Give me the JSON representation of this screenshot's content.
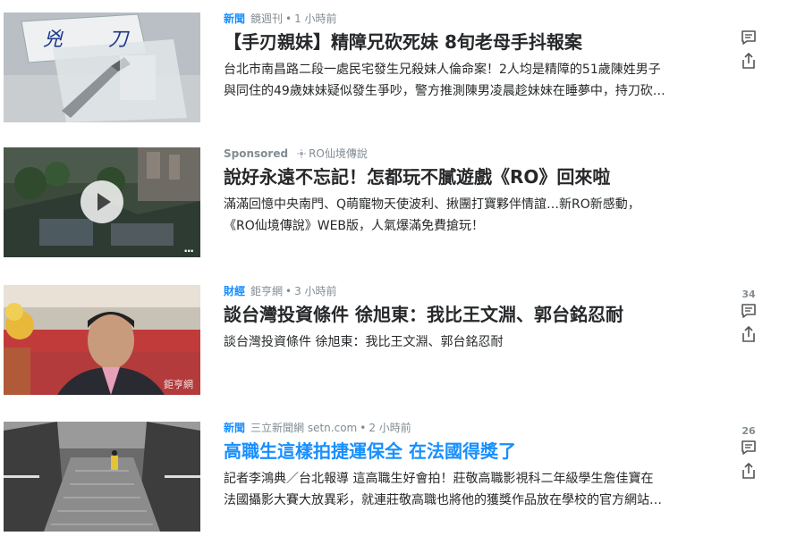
{
  "items": [
    {
      "category": "新聞",
      "source": "鏡週刊",
      "time": "1 小時前",
      "title": "【手刃親妹】精障兄砍死妹 8旬老母手抖報案",
      "summary_line1": "台北市南昌路二段一處民宅發生兄殺妹人倫命案！2人均是精障的51歲陳姓男子",
      "summary_line2": "與同住的49歲妹妹疑似發生爭吵，警方推測陳男凌晨趁妹妹在睡夢中，持刀砍…",
      "comment_count": "",
      "thumb_sign_text": "兇 刀"
    },
    {
      "category": "Sponsored",
      "source": "RO仙境傳說",
      "time": "",
      "title": "說好永遠不忘記！怎都玩不膩遊戲《RO》回來啦",
      "summary_line1": "滿滿回憶中央南門、Q萌寵物天使波利、揪團打寶夥伴情誼…新RO新感動，",
      "summary_line2": "《RO仙境傳說》WEB版，人氣爆滿免費搶玩！",
      "comment_count": "",
      "thumb_overlay": "..."
    },
    {
      "category": "財經",
      "source": "鉅亨網",
      "time": "3 小時前",
      "title": "談台灣投資條件 徐旭東：我比王文淵、郭台銘忍耐",
      "summary_line1": "談台灣投資條件 徐旭東：我比王文淵、郭台銘忍耐",
      "summary_line2": "",
      "comment_count": "34",
      "thumb_watermark": "鉅亨網"
    },
    {
      "category": "新聞",
      "source": "三立新聞網 setn.com",
      "time": "2 小時前",
      "title": "高職生這樣拍捷運保全 在法國得獎了",
      "summary_line1": "記者李鴻典／台北報導 這高職生好會拍！莊敬高職影視科二年級學生詹佳寶在",
      "summary_line2": "法國攝影大賽大放異彩，就連莊敬高職也將他的獲獎作品放在學校的官方網站…",
      "comment_count": "26"
    }
  ],
  "icons": {
    "comment": "comment-icon",
    "share": "share-icon",
    "play": "play-icon",
    "sponsored": "sun-icon"
  },
  "colors": {
    "category": "#188fff",
    "meta": "#828c93",
    "title": "#26282a",
    "title_link": "#188fff"
  }
}
